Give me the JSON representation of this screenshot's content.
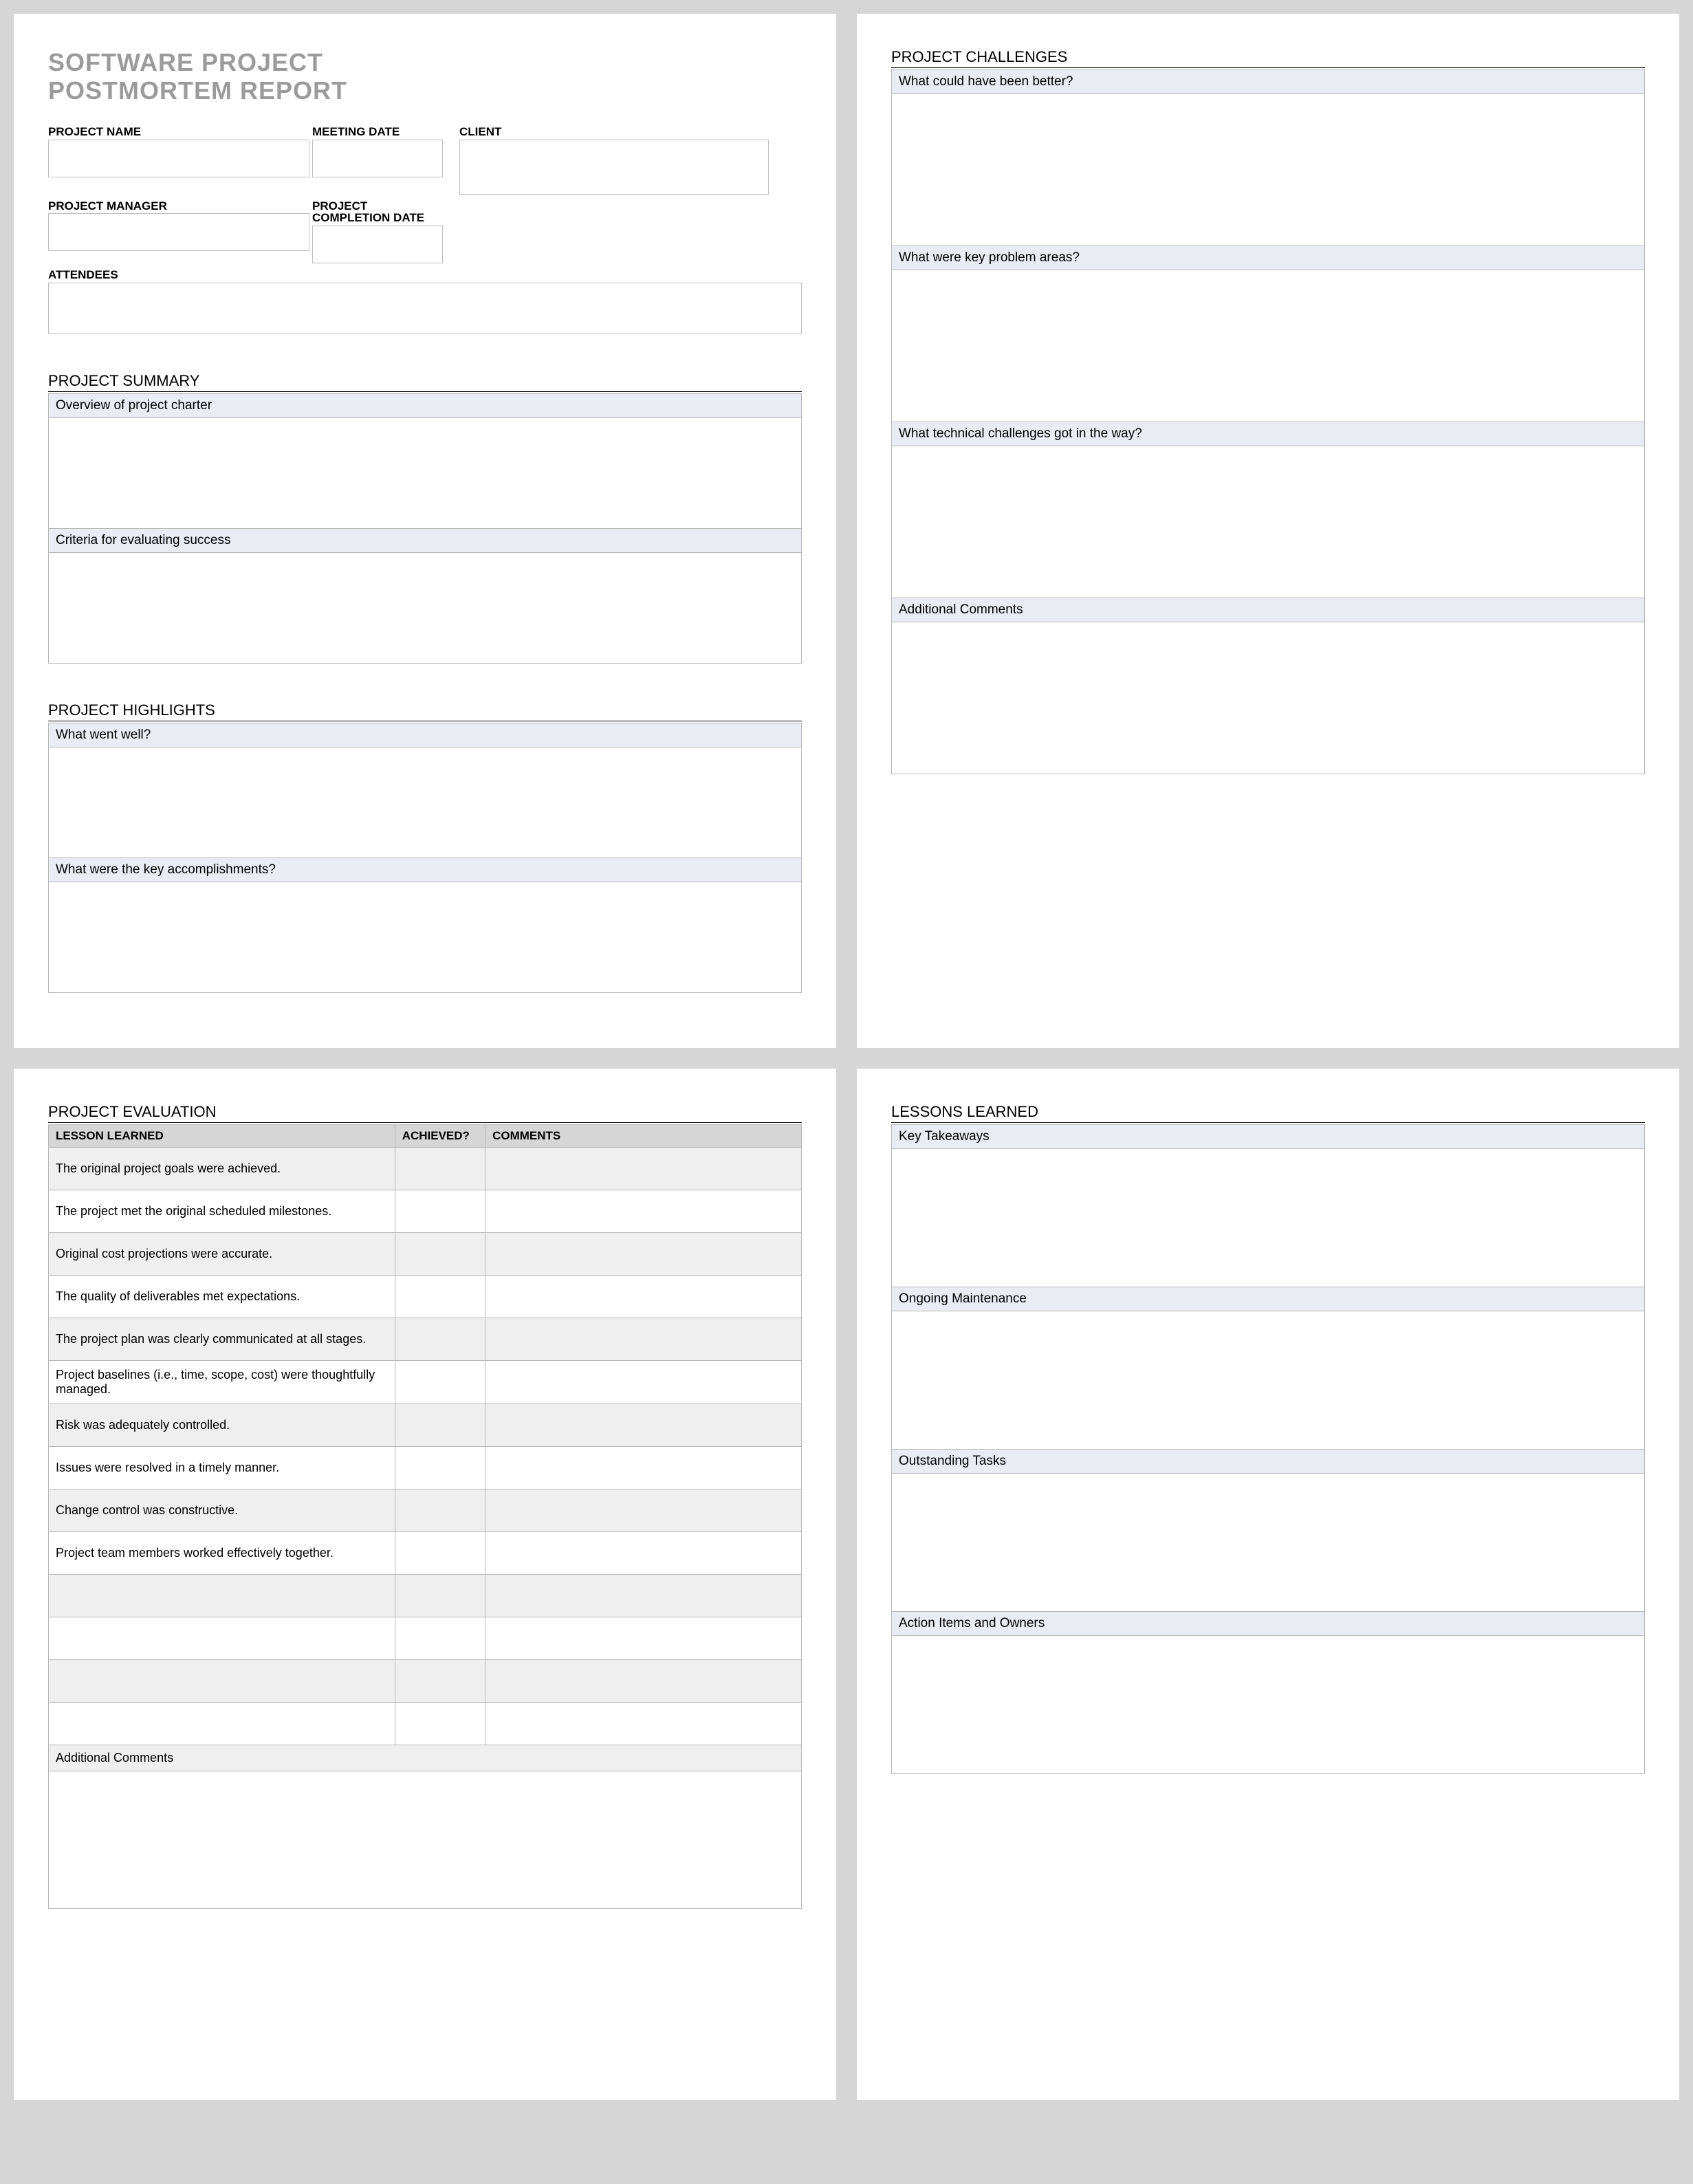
{
  "title": "SOFTWARE PROJECT\nPOSTMORTEM REPORT",
  "meta": {
    "project_name_label": "PROJECT NAME",
    "meeting_date_label": "MEETING DATE",
    "client_label": "CLIENT",
    "project_manager_label": "PROJECT MANAGER",
    "project_completion_label": "PROJECT COMPLETION DATE",
    "attendees_label": "ATTENDEES"
  },
  "summary": {
    "heading": "PROJECT SUMMARY",
    "q1": "Overview of project charter",
    "q2": "Criteria for evaluating success"
  },
  "highlights": {
    "heading": "PROJECT HIGHLIGHTS",
    "q1": "What went well?",
    "q2": "What were the key accomplishments?"
  },
  "challenges": {
    "heading": "PROJECT CHALLENGES",
    "q1": "What could have been better?",
    "q2": "What were key problem areas?",
    "q3": "What technical challenges got in the way?",
    "q4": "Additional Comments"
  },
  "evaluation": {
    "heading": "PROJECT EVALUATION",
    "col1": "LESSON LEARNED",
    "col2": "ACHIEVED?",
    "col3": "COMMENTS",
    "rows": [
      "The original project goals were achieved.",
      "The project met the original scheduled milestones.",
      "Original cost projections were accurate.",
      "The quality of deliverables met expectations.",
      "The project plan was clearly communicated at all stages.",
      "Project baselines (i.e., time, scope, cost) were thoughtfully managed.",
      "Risk was adequately controlled.",
      "Issues were resolved in a timely manner.",
      "Change control was constructive.",
      "Project team members worked effectively together.",
      "",
      "",
      "",
      ""
    ],
    "addl_label": "Additional Comments"
  },
  "lessons": {
    "heading": "LESSONS LEARNED",
    "q1": "Key Takeaways",
    "q2": "Ongoing Maintenance",
    "q3": "Outstanding Tasks",
    "q4": "Action Items and Owners"
  }
}
